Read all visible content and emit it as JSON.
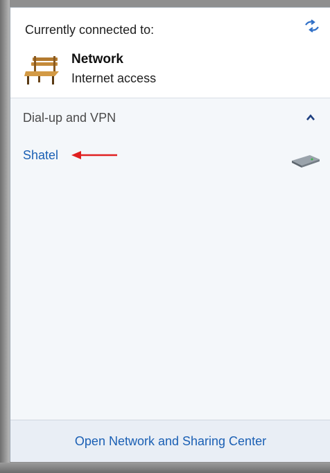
{
  "current": {
    "title": "Currently connected to:",
    "network_name": "Network",
    "network_status": "Internet access",
    "network_icon": "bench-icon",
    "refresh_icon": "refresh-icon"
  },
  "dialup": {
    "header": "Dial-up and VPN",
    "collapse_icon": "chevron-up-icon",
    "items": [
      {
        "label": "Shatel",
        "icon": "modem-icon"
      }
    ]
  },
  "annotation": {
    "arrow_color": "#e02020",
    "icon": "red-arrow-icon"
  },
  "footer": {
    "link": "Open Network and Sharing Center"
  },
  "colors": {
    "link": "#1a5fb4",
    "list_background": "#f4f7fa",
    "footer_background": "#e9eef5"
  }
}
